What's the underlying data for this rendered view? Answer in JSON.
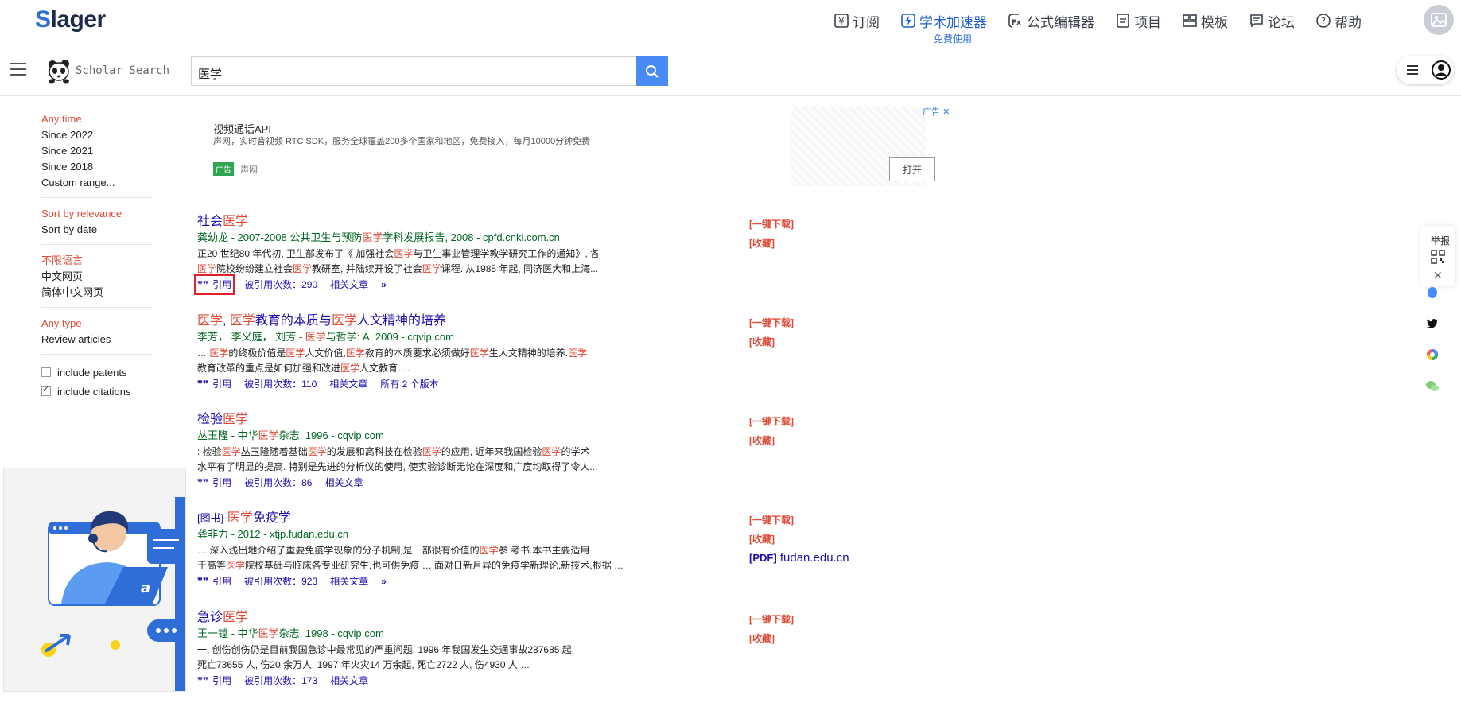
{
  "topbar": {
    "logo_first": "S",
    "logo_rest": "lager",
    "nav": [
      {
        "label": "订阅",
        "icon": "yen-icon"
      },
      {
        "label": "学术加速器",
        "icon": "lightning-icon",
        "sub": "免费使用",
        "active": true
      },
      {
        "label": "公式编辑器",
        "icon": "formula-icon"
      },
      {
        "label": "项目",
        "icon": "document-icon"
      },
      {
        "label": "模板",
        "icon": "template-icon"
      },
      {
        "label": "论坛",
        "icon": "chat-icon"
      },
      {
        "label": "帮助",
        "icon": "help-icon"
      }
    ]
  },
  "search": {
    "brand": "Scholar Search",
    "query": "医学"
  },
  "filters": {
    "time": [
      "Any time",
      "Since 2022",
      "Since 2021",
      "Since 2018",
      "Custom range..."
    ],
    "sort": [
      "Sort by relevance",
      "Sort by date"
    ],
    "lang": [
      "不限语言",
      "中文网页",
      "简体中文网页"
    ],
    "type": [
      "Any type",
      "Review articles"
    ],
    "include_patents": "include patents",
    "include_citations": "include citations"
  },
  "ad": {
    "title": "视频通话API",
    "desc": "声网，实时音视频 RTC SDK，服务全球覆盖200多个国家和地区，免费接入，每月10000分钟免费",
    "badge": "广告",
    "source": "声网",
    "tag": "广告",
    "open": "打开"
  },
  "results": [
    {
      "title_a": "社会",
      "title_hl": "医学",
      "meta_a": "龚幼龙 - 2007-2008 公共卫生与预防",
      "meta_hl": "医学",
      "meta_b": "学科发展报告, 2008 - cpfd.cnki.com.cn",
      "snip1_a": "正20 世纪80 年代初, 卫生部发布了《 加强社会",
      "snip1_hl": "医学",
      "snip1_b": "与卫生事业管理学教学研究工作的通知》, 各",
      "snip2_hl1": "医学",
      "snip2_a": "院校纷纷建立社会",
      "snip2_hl2": "医学",
      "snip2_b": "教研室, 并陆续开设了社会",
      "snip2_hl3": "医学",
      "snip2_c": "课程. 从1985 年起, 同济医大和上海...",
      "cite": "引用",
      "cited": "被引用次数：290",
      "related": "相关文章",
      "side1": "[一键下载]",
      "side2": "[收藏]"
    },
    {
      "title_hl1": "医学",
      "title_a": ", ",
      "title_hl2": "医学",
      "title_b": "教育的本质与",
      "title_hl3": "医学",
      "title_c": "人文精神的培养",
      "meta_a": "李芳， 李义庭， 刘芳 - ",
      "meta_hl": "医学",
      "meta_b": "与哲学: A, 2009 - cqvip.com",
      "snip1": "… 医学的终极价值是医学人文价值,医学教育的本质要求必须做好医学生人文精神的培养.医学",
      "snip2": "教育改革的重点是如何加强和改进医学人文教育….",
      "cite": "引用",
      "cited": "被引用次数：110",
      "related": "相关文章",
      "versions": "所有 2 个版本",
      "side1": "[一键下载]",
      "side2": "[收藏]"
    },
    {
      "title_a": "检验",
      "title_hl": "医学",
      "meta_a": "丛玉隆 - 中华",
      "meta_hl": "医学",
      "meta_b": "杂志, 1996 - cqvip.com",
      "snip1": ": 检验医学丛玉隆随着基础医学的发展和高科技在检验医学的应用, 近年来我国检验医学的学术",
      "snip2": "水平有了明显的提高. 特别是先进的分析仪的使用, 使实验诊断无论在深度和广度均取得了令人...",
      "cite": "引用",
      "cited": "被引用次数：86",
      "related": "相关文章",
      "side1": "[一键下载]",
      "side2": "[收藏]"
    },
    {
      "pre": "[图书]",
      "title_hl": "医学",
      "title_a": "免疫学",
      "meta": "龚非力 - 2012 - xtjp.fudan.edu.cn",
      "snip1": "… 深入浅出地介绍了重要免疫学现象的分子机制,是一部很有价值的医学参 考书.本书主要适用",
      "snip2": "于高等医学院校基础与临床各专业研究生,也可供免疫 … 面对日新月异的免疫学新理论,新技术,根据 …",
      "cite": "引用",
      "cited": "被引用次数：923",
      "related": "相关文章",
      "side1": "[一键下载]",
      "side2": "[收藏]",
      "pdf_tag": "[PDF]",
      "pdf_host": "fudan.edu.cn"
    },
    {
      "title_a": "急诊",
      "title_hl": "医学",
      "meta_a": "王一镗 - 中华",
      "meta_hl": "医学",
      "meta_b": "杂志, 1998 - cqvip.com",
      "snip1": "一, 创伤创伤仍是目前我国急诊中最常见的严重问题. 1996 年我国发生交通事故287685 起,",
      "snip2": "死亡73655 人, 伤20 余万人. 1997 年火灾14 万余起, 死亡2722 人, 伤4930 人 …",
      "cite": "引用",
      "cited": "被引用次数：173",
      "related": "相关文章",
      "side1": "[一键下载]",
      "side2": "[收藏]"
    }
  ],
  "floatbar": {
    "report": "举报"
  }
}
